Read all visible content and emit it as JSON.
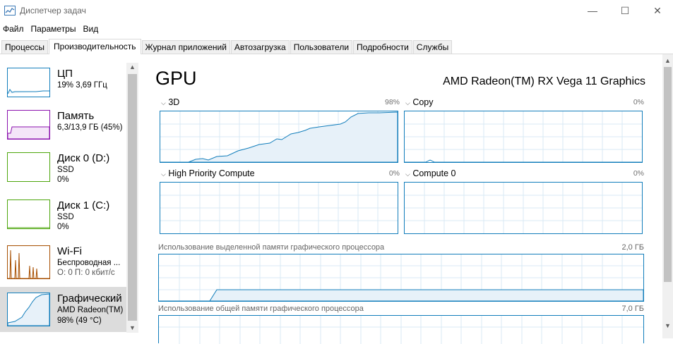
{
  "window": {
    "title": "Диспетчер задач",
    "minimize": "—",
    "maximize": "☐",
    "close": "✕"
  },
  "menu": [
    "Файл",
    "Параметры",
    "Вид"
  ],
  "tabs": [
    "Процессы",
    "Производительность",
    "Журнал приложений",
    "Автозагрузка",
    "Пользователи",
    "Подробности",
    "Службы"
  ],
  "active_tab": "Производительность",
  "sidebar": {
    "items": [
      {
        "title": "ЦП",
        "line1": "19% 3,69 ГГц",
        "line2": "",
        "color": "#117dbb"
      },
      {
        "title": "Память",
        "line1": "6,3/13,9 ГБ (45%)",
        "line2": "",
        "color": "#8b12ae"
      },
      {
        "title": "Диск 0 (D:)",
        "line1": "SSD",
        "line2": "0%",
        "color": "#4da60c"
      },
      {
        "title": "Диск 1 (C:)",
        "line1": "SSD",
        "line2": "0%",
        "color": "#4da60c"
      },
      {
        "title": "Wi-Fi",
        "line1": "Беспроводная ...",
        "line2": "О: 0 П: 0 кбит/с",
        "color": "#a74f01"
      },
      {
        "title": "Графический",
        "line1": "AMD Radeon(TM)",
        "line2": "98% (49 °C)",
        "color": "#117dbb"
      }
    ],
    "selected": 5
  },
  "main": {
    "title": "GPU",
    "model": "AMD Radeon(TM) RX Vega 11 Graphics",
    "graphs": [
      {
        "label": "3D",
        "value": "98%"
      },
      {
        "label": "Copy",
        "value": "0%"
      },
      {
        "label": "High Priority Compute",
        "value": "0%"
      },
      {
        "label": "Compute 0",
        "value": "0%"
      }
    ],
    "dedicated_memory": {
      "label": "Использование выделенной памяти графического процессора",
      "value": "2,0 ГБ"
    },
    "shared_memory": {
      "label": "Использование общей памяти графического процессора",
      "value": "7,0 ГБ"
    }
  },
  "accent_color": "#117dbb"
}
